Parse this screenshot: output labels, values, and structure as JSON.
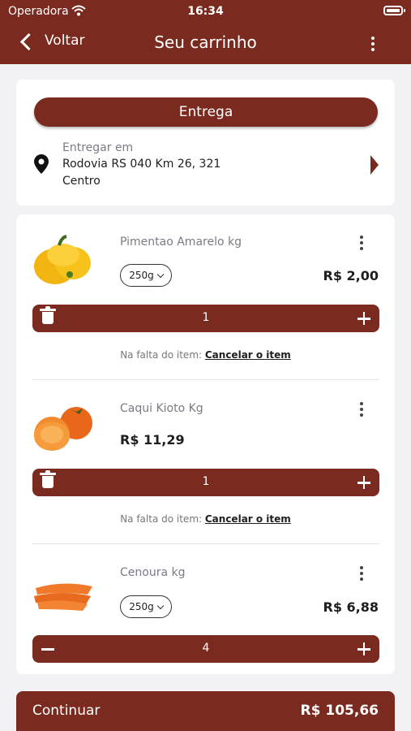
{
  "status_bar": {
    "carrier": "Operadora",
    "time": "16:34"
  },
  "header": {
    "back_label": "Voltar",
    "title": "Seu carrinho"
  },
  "delivery": {
    "button_label": "Entrega",
    "address_label": "Entregar em",
    "address_line1": "Rodovia RS 040 Km 26, 321",
    "address_line2": "Centro"
  },
  "items": [
    {
      "name": "Pimentao Amarelo  kg",
      "unit": "250g",
      "price": "R$ 2,00",
      "quantity": "1",
      "left_control": "trash-icon",
      "missing_text": "Na falta do item:",
      "missing_action": "Cancelar o item"
    },
    {
      "name": "Caqui Kioto Kg",
      "price": "R$ 11,29",
      "quantity": "1",
      "left_control": "trash-icon",
      "missing_text": "Na falta do item:",
      "missing_action": "Cancelar o item"
    },
    {
      "name": "Cenoura kg",
      "unit": "250g",
      "price": "R$ 6,88",
      "quantity": "4",
      "left_control": "minus-icon"
    }
  ],
  "footer": {
    "continue_label": "Continuar",
    "total": "R$ 105,66"
  },
  "colors": {
    "primary": "#7a2a1e",
    "background": "#f2f2f4",
    "muted_text": "#7a7a86"
  }
}
